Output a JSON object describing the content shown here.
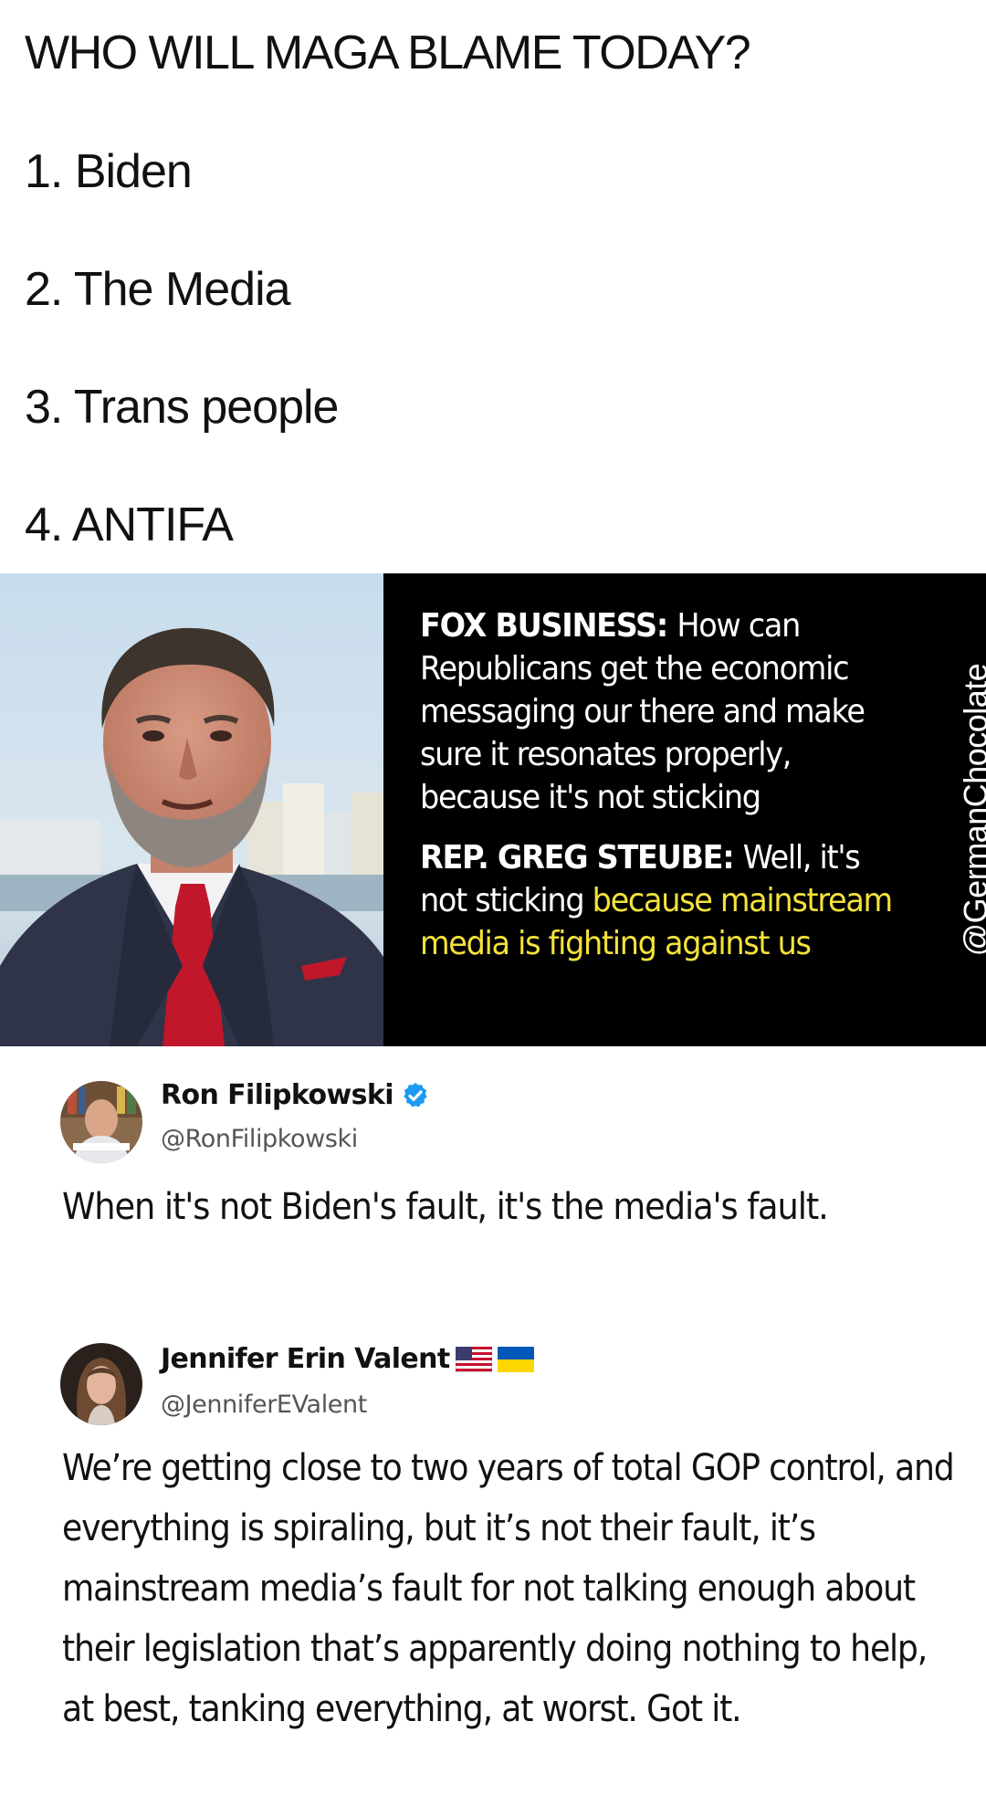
{
  "headline": "WHO WILL MAGA BLAME TODAY?",
  "list": [
    "1. Biden",
    "2. The Media",
    "3. Trans people",
    "4. ANTIFA"
  ],
  "news_panel": {
    "question_speaker": "FOX BUSINESS",
    "question_text": "How can Republicans get the economic messaging our there and make sure it resonates properly, because it's not sticking",
    "answer_speaker": "REP. GREG STEUBE",
    "answer_text_plain": "Well, it's not sticking",
    "answer_text_highlight": "because mainstream media is fighting against us",
    "highlight_color": "#f4e33a",
    "watermark": "@GermanChocolate"
  },
  "tweets": [
    {
      "name": "Ron Filipkowski",
      "handle": "@RonFilipkowski",
      "verified": true,
      "text": "When it's not Biden's fault, it's the media's fault."
    },
    {
      "name": "Jennifer Erin Valent",
      "handle": "@JenniferEValent",
      "flags": [
        "us-flag-icon",
        "ukraine-flag-icon"
      ],
      "text": "We’re getting close to two years of total GOP control, and everything is spiraling, but it’s not their fault, it’s mainstream media’s fault for not talking enough about their legislation that’s apparently doing nothing to help, at best, tanking everything, at worst. Got it."
    }
  ],
  "colors": {
    "verified_badge": "#1d9bf0",
    "panel_background": "#000000"
  }
}
